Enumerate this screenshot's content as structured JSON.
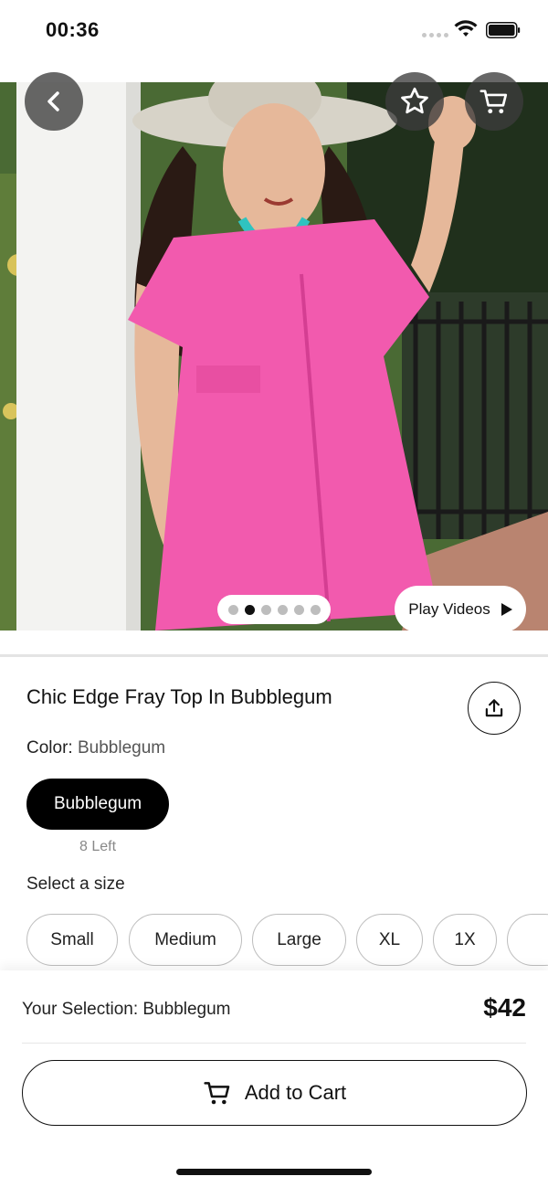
{
  "status_bar": {
    "time": "00:36"
  },
  "product": {
    "title": "Chic Edge Fray Top In Bubblegum",
    "color_label": "Color:",
    "color_value": "Bubblegum",
    "swatch_label": "Bubblegum",
    "stock_left": "8 Left",
    "size_prompt": "Select a size",
    "sizes": [
      "Small",
      "Medium",
      "Large",
      "XL",
      "1X"
    ],
    "carousel": {
      "total": 6,
      "active_index": 1
    }
  },
  "media": {
    "play_videos_label": "Play Videos"
  },
  "icons": {
    "back": "chevron-left-icon",
    "favorite": "star-icon",
    "cart": "cart-icon",
    "share": "share-icon",
    "play": "play-icon"
  },
  "footer": {
    "selection_text": "Your Selection: Bubblegum",
    "price": "$42",
    "add_to_cart_label": "Add to Cart"
  },
  "colors": {
    "accent": "#000000",
    "product_pink": "#f25aae",
    "turquoise": "#2fc3c0"
  }
}
